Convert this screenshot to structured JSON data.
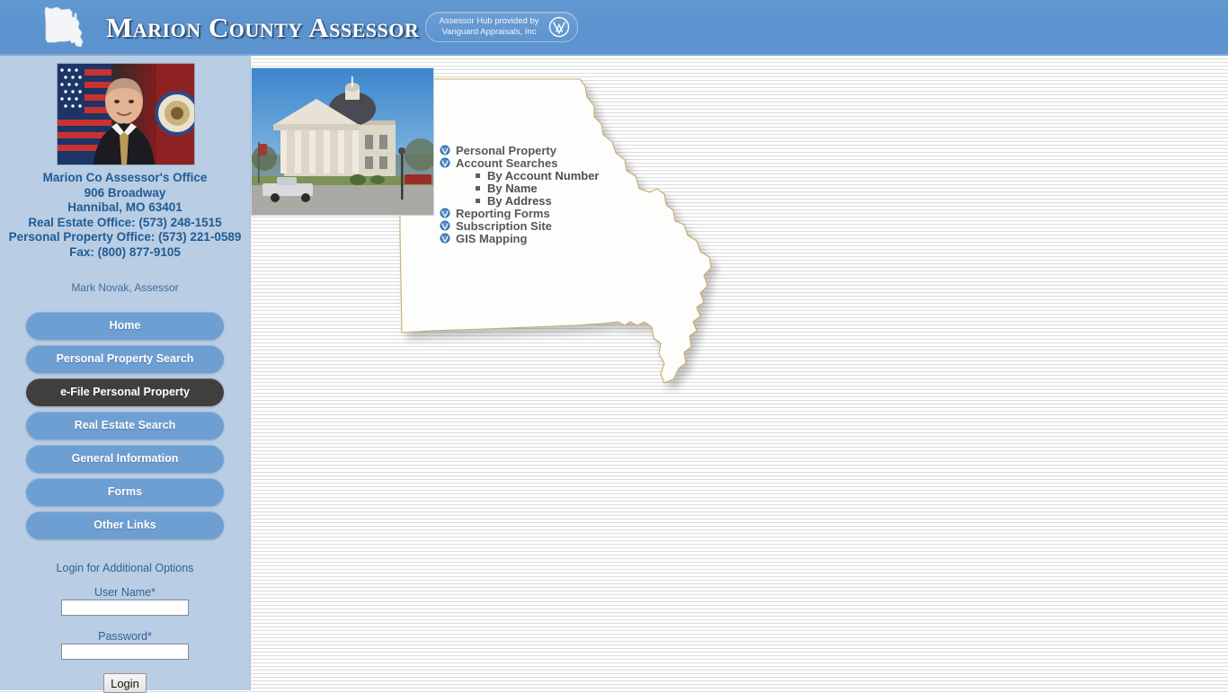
{
  "header": {
    "title": "Marion County Assessor",
    "state_outline_icon": "missouri-state-icon",
    "hub_badge": {
      "line1": "Assessor Hub provided by",
      "line2": "Vanguard Appraisals, Inc",
      "logo_icon": "vanguard-logo-icon"
    },
    "background_color": "#5b93cf"
  },
  "sidebar": {
    "background_color": "#b9cde4",
    "portrait_alt": "assessor-portrait",
    "office": {
      "name": "Marion Co Assessor's Office",
      "street": "906 Broadway",
      "city_state_zip": "Hannibal, MO 63401",
      "real_estate_phone": "Real Estate Office: (573) 248-1515",
      "personal_property_phone": "Personal Property Office: (573) 221-0589",
      "fax": "Fax: (800) 877-9105"
    },
    "assessor_name": "Mark Novak, Assessor",
    "nav_items": [
      {
        "label": "Home",
        "active": false
      },
      {
        "label": "Personal Property Search",
        "active": false
      },
      {
        "label": "e-File Personal Property",
        "active": true
      },
      {
        "label": "Real Estate Search",
        "active": false
      },
      {
        "label": "General Information",
        "active": false
      },
      {
        "label": "Forms",
        "active": false
      },
      {
        "label": "Other Links",
        "active": false
      }
    ],
    "login": {
      "heading": "Login for Additional Options",
      "username_label": "User Name*",
      "username_value": "",
      "password_label": "Password*",
      "password_value": "",
      "button_label": "Login"
    },
    "accent_color": "#1f5c94",
    "active_nav_color": "#413f3d",
    "nav_color": "#6d9fd2"
  },
  "main": {
    "courthouse_photo_alt": "marion-county-courthouse-photo",
    "state_map_alt": "missouri-state-map",
    "menu": [
      {
        "label": "Personal Property",
        "icon": "vanguard-bullet-icon",
        "children": []
      },
      {
        "label": "Account Searches",
        "icon": "vanguard-bullet-icon",
        "children": [
          {
            "label": "By Account Number"
          },
          {
            "label": "By Name"
          },
          {
            "label": "By Address"
          }
        ]
      },
      {
        "label": "Reporting Forms",
        "icon": "vanguard-bullet-icon",
        "children": []
      },
      {
        "label": "Subscription Site",
        "icon": "vanguard-bullet-icon",
        "children": []
      },
      {
        "label": "GIS Mapping",
        "icon": "vanguard-bullet-icon",
        "children": []
      }
    ]
  }
}
